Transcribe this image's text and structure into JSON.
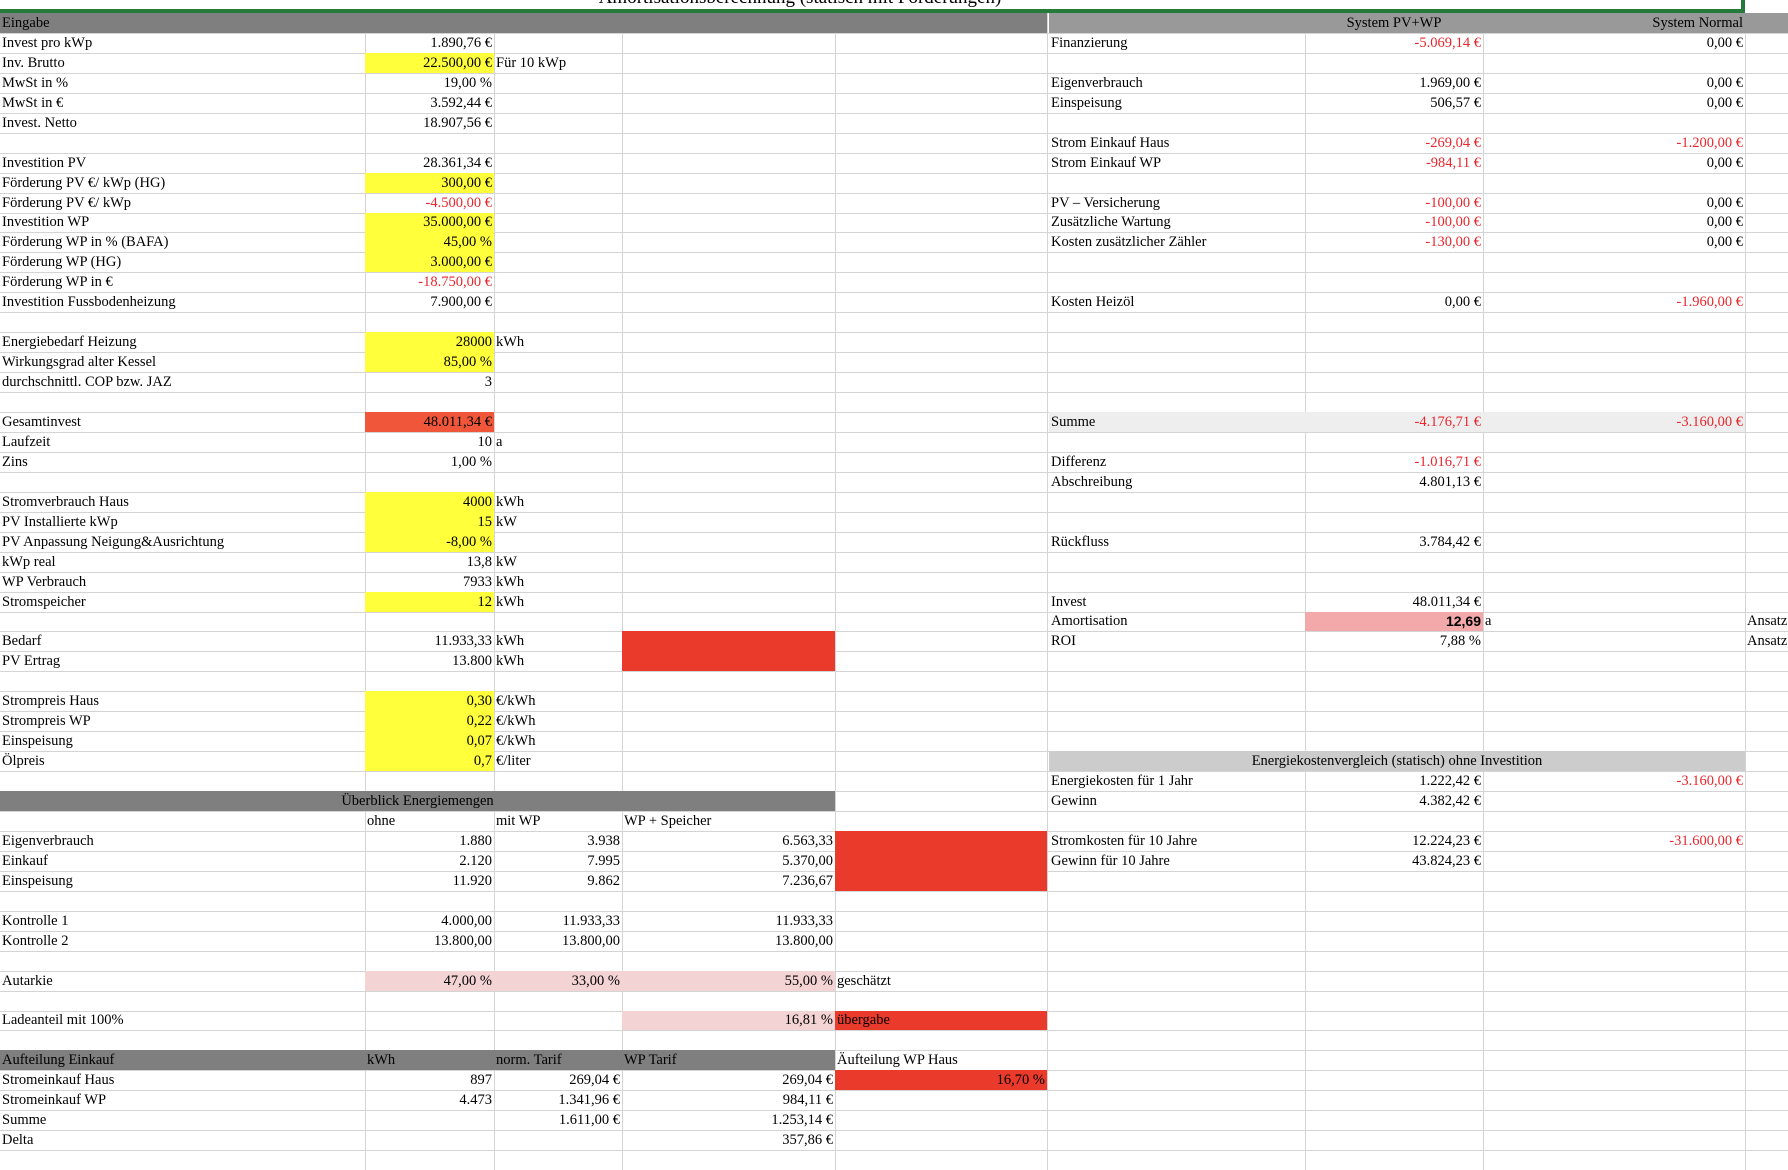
{
  "sheet_title": "Amortisationsberechnung (statisch mit Förderungen)",
  "cells": [
    {
      "r": 0,
      "c": 0,
      "t": "Eingabe"
    },
    {
      "r": 0,
      "c": 7,
      "t": "System PV+WP"
    },
    {
      "r": 0,
      "c": 8,
      "t": "System Normal"
    },
    {
      "r": 1,
      "c": 0,
      "t": "Invest pro kWp"
    },
    {
      "r": 1,
      "c": 1,
      "t": "1.890,76 €"
    },
    {
      "r": 1,
      "c": 6,
      "t": "Finanzierung"
    },
    {
      "r": 1,
      "c": 7,
      "t": "-5.069,14 €"
    },
    {
      "r": 1,
      "c": 8,
      "t": "0,00 €"
    },
    {
      "r": 2,
      "c": 0,
      "t": "Inv. Brutto"
    },
    {
      "r": 2,
      "c": 1,
      "t": "22.500,00 €"
    },
    {
      "r": 2,
      "c": 2,
      "t": "Für 10 kWp"
    },
    {
      "r": 3,
      "c": 0,
      "t": "MwSt in %"
    },
    {
      "r": 3,
      "c": 1,
      "t": "19,00 %"
    },
    {
      "r": 3,
      "c": 6,
      "t": "Eigenverbrauch"
    },
    {
      "r": 3,
      "c": 7,
      "t": "1.969,00 €"
    },
    {
      "r": 3,
      "c": 8,
      "t": "0,00 €"
    },
    {
      "r": 4,
      "c": 0,
      "t": "MwSt in €"
    },
    {
      "r": 4,
      "c": 1,
      "t": "3.592,44 €"
    },
    {
      "r": 4,
      "c": 6,
      "t": "Einspeisung"
    },
    {
      "r": 4,
      "c": 7,
      "t": "506,57 €"
    },
    {
      "r": 4,
      "c": 8,
      "t": "0,00 €"
    },
    {
      "r": 5,
      "c": 0,
      "t": "Invest. Netto"
    },
    {
      "r": 5,
      "c": 1,
      "t": "18.907,56 €"
    },
    {
      "r": 6,
      "c": 6,
      "t": "Strom Einkauf Haus"
    },
    {
      "r": 6,
      "c": 7,
      "t": "-269,04 €"
    },
    {
      "r": 6,
      "c": 8,
      "t": "-1.200,00 €"
    },
    {
      "r": 7,
      "c": 0,
      "t": "Investition PV"
    },
    {
      "r": 7,
      "c": 1,
      "t": "28.361,34 €"
    },
    {
      "r": 7,
      "c": 6,
      "t": "Strom Einkauf WP"
    },
    {
      "r": 7,
      "c": 7,
      "t": "-984,11 €"
    },
    {
      "r": 7,
      "c": 8,
      "t": "0,00 €"
    },
    {
      "r": 8,
      "c": 0,
      "t": "Förderung PV €/ kWp (HG)"
    },
    {
      "r": 8,
      "c": 1,
      "t": "300,00 €"
    },
    {
      "r": 9,
      "c": 0,
      "t": "Förderung PV €/ kWp"
    },
    {
      "r": 9,
      "c": 1,
      "t": "-4.500,00 €"
    },
    {
      "r": 9,
      "c": 6,
      "t": "PV – Versicherung"
    },
    {
      "r": 9,
      "c": 7,
      "t": "-100,00 €"
    },
    {
      "r": 9,
      "c": 8,
      "t": "0,00 €"
    },
    {
      "r": 10,
      "c": 0,
      "t": "Investition WP"
    },
    {
      "r": 10,
      "c": 1,
      "t": "35.000,00 €"
    },
    {
      "r": 10,
      "c": 6,
      "t": "Zusätzliche Wartung"
    },
    {
      "r": 10,
      "c": 7,
      "t": "-100,00 €"
    },
    {
      "r": 10,
      "c": 8,
      "t": "0,00 €"
    },
    {
      "r": 11,
      "c": 0,
      "t": "Förderung WP in % (BAFA)"
    },
    {
      "r": 11,
      "c": 1,
      "t": "45,00 %"
    },
    {
      "r": 11,
      "c": 6,
      "t": "Kosten zusätzlicher Zähler"
    },
    {
      "r": 11,
      "c": 7,
      "t": "-130,00 €"
    },
    {
      "r": 11,
      "c": 8,
      "t": "0,00 €"
    },
    {
      "r": 12,
      "c": 0,
      "t": "Förderung WP (HG)"
    },
    {
      "r": 12,
      "c": 1,
      "t": "3.000,00 €"
    },
    {
      "r": 13,
      "c": 0,
      "t": "Förderung WP in €"
    },
    {
      "r": 13,
      "c": 1,
      "t": "-18.750,00 €"
    },
    {
      "r": 14,
      "c": 0,
      "t": "Investition Fussbodenheizung"
    },
    {
      "r": 14,
      "c": 1,
      "t": "7.900,00 €"
    },
    {
      "r": 14,
      "c": 6,
      "t": "Kosten Heizöl"
    },
    {
      "r": 14,
      "c": 7,
      "t": "0,00 €"
    },
    {
      "r": 14,
      "c": 8,
      "t": "-1.960,00 €"
    },
    {
      "r": 16,
      "c": 0,
      "t": "Energiebedarf Heizung"
    },
    {
      "r": 16,
      "c": 1,
      "t": "28000"
    },
    {
      "r": 16,
      "c": 2,
      "t": "kWh"
    },
    {
      "r": 17,
      "c": 0,
      "t": "Wirkungsgrad alter Kessel"
    },
    {
      "r": 17,
      "c": 1,
      "t": "85,00 %"
    },
    {
      "r": 18,
      "c": 0,
      "t": "durchschnittl. COP bzw. JAZ"
    },
    {
      "r": 18,
      "c": 1,
      "t": "3"
    },
    {
      "r": 20,
      "c": 0,
      "t": "Gesamtinvest"
    },
    {
      "r": 20,
      "c": 1,
      "t": "48.011,34 €"
    },
    {
      "r": 20,
      "c": 6,
      "t": "Summe"
    },
    {
      "r": 20,
      "c": 7,
      "t": "-4.176,71 €"
    },
    {
      "r": 20,
      "c": 8,
      "t": "-3.160,00 €"
    },
    {
      "r": 21,
      "c": 0,
      "t": "Laufzeit"
    },
    {
      "r": 21,
      "c": 1,
      "t": "10"
    },
    {
      "r": 21,
      "c": 2,
      "t": "a"
    },
    {
      "r": 22,
      "c": 0,
      "t": "Zins"
    },
    {
      "r": 22,
      "c": 1,
      "t": "1,00 %"
    },
    {
      "r": 22,
      "c": 6,
      "t": "Differenz"
    },
    {
      "r": 22,
      "c": 7,
      "t": "-1.016,71 €"
    },
    {
      "r": 23,
      "c": 6,
      "t": "Abschreibung"
    },
    {
      "r": 23,
      "c": 7,
      "t": "4.801,13 €"
    },
    {
      "r": 24,
      "c": 0,
      "t": "Stromverbrauch Haus"
    },
    {
      "r": 24,
      "c": 1,
      "t": "4000"
    },
    {
      "r": 24,
      "c": 2,
      "t": "kWh"
    },
    {
      "r": 25,
      "c": 0,
      "t": "PV Installierte kWp"
    },
    {
      "r": 25,
      "c": 1,
      "t": "15"
    },
    {
      "r": 25,
      "c": 2,
      "t": "kW"
    },
    {
      "r": 26,
      "c": 0,
      "t": "PV Anpassung Neigung&Ausrichtung"
    },
    {
      "r": 26,
      "c": 1,
      "t": "-8,00 %"
    },
    {
      "r": 26,
      "c": 6,
      "t": "Rückfluss"
    },
    {
      "r": 26,
      "c": 7,
      "t": "3.784,42 €"
    },
    {
      "r": 27,
      "c": 0,
      "t": "kWp real"
    },
    {
      "r": 27,
      "c": 1,
      "t": "13,8"
    },
    {
      "r": 27,
      "c": 2,
      "t": "kW"
    },
    {
      "r": 28,
      "c": 0,
      "t": "WP Verbrauch"
    },
    {
      "r": 28,
      "c": 1,
      "t": "7933"
    },
    {
      "r": 28,
      "c": 2,
      "t": "kWh"
    },
    {
      "r": 29,
      "c": 0,
      "t": "Stromspeicher"
    },
    {
      "r": 29,
      "c": 1,
      "t": "12"
    },
    {
      "r": 29,
      "c": 2,
      "t": "kWh"
    },
    {
      "r": 29,
      "c": 6,
      "t": "Invest"
    },
    {
      "r": 29,
      "c": 7,
      "t": "48.011,34 €"
    },
    {
      "r": 30,
      "c": 6,
      "t": "Amortisation"
    },
    {
      "r": 30,
      "c": 7,
      "t": "12,69"
    },
    {
      "r": 30,
      "c": 8,
      "t": "a"
    },
    {
      "r": 30,
      "c": 10,
      "t": "Ansatz"
    },
    {
      "r": 31,
      "c": 0,
      "t": "Bedarf"
    },
    {
      "r": 31,
      "c": 1,
      "t": "11.933,33"
    },
    {
      "r": 31,
      "c": 2,
      "t": "kWh"
    },
    {
      "r": 31,
      "c": 6,
      "t": "ROI"
    },
    {
      "r": 31,
      "c": 7,
      "t": "7,88 %"
    },
    {
      "r": 31,
      "c": 10,
      "t": "Ansatz"
    },
    {
      "r": 32,
      "c": 0,
      "t": "PV Ertrag"
    },
    {
      "r": 32,
      "c": 1,
      "t": "13.800"
    },
    {
      "r": 32,
      "c": 2,
      "t": "kWh"
    },
    {
      "r": 34,
      "c": 0,
      "t": "Strompreis Haus"
    },
    {
      "r": 34,
      "c": 1,
      "t": "0,30"
    },
    {
      "r": 34,
      "c": 2,
      "t": "€/kWh"
    },
    {
      "r": 35,
      "c": 0,
      "t": "Strompreis WP"
    },
    {
      "r": 35,
      "c": 1,
      "t": "0,22"
    },
    {
      "r": 35,
      "c": 2,
      "t": "€/kWh"
    },
    {
      "r": 36,
      "c": 0,
      "t": "Einspeisung"
    },
    {
      "r": 36,
      "c": 1,
      "t": "0,07"
    },
    {
      "r": 36,
      "c": 2,
      "t": "€/kWh"
    },
    {
      "r": 37,
      "c": 0,
      "t": "Ölpreis"
    },
    {
      "r": 37,
      "c": 1,
      "t": "0,7"
    },
    {
      "r": 37,
      "c": 2,
      "t": "€/liter"
    },
    {
      "r": 37,
      "c": 6,
      "t": "Energiekostenvergleich (statisch) ohne Investition"
    },
    {
      "r": 38,
      "c": 6,
      "t": "Energiekosten für 1 Jahr"
    },
    {
      "r": 38,
      "c": 7,
      "t": "1.222,42 €"
    },
    {
      "r": 38,
      "c": 8,
      "t": "-3.160,00 €"
    },
    {
      "r": 39,
      "c": 0,
      "t": "Überblick Energiemengen"
    },
    {
      "r": 39,
      "c": 6,
      "t": "Gewinn"
    },
    {
      "r": 39,
      "c": 7,
      "t": "4.382,42 €"
    },
    {
      "r": 40,
      "c": 1,
      "t": "ohne"
    },
    {
      "r": 40,
      "c": 2,
      "t": "mit WP"
    },
    {
      "r": 40,
      "c": 3,
      "t": "WP + Speicher"
    },
    {
      "r": 41,
      "c": 0,
      "t": "Eigenverbrauch"
    },
    {
      "r": 41,
      "c": 1,
      "t": "1.880"
    },
    {
      "r": 41,
      "c": 2,
      "t": "3.938"
    },
    {
      "r": 41,
      "c": 3,
      "t": "6.563,33"
    },
    {
      "r": 41,
      "c": 6,
      "t": "Stromkosten für 10 Jahre"
    },
    {
      "r": 41,
      "c": 7,
      "t": "12.224,23 €"
    },
    {
      "r": 41,
      "c": 8,
      "t": "-31.600,00 €"
    },
    {
      "r": 42,
      "c": 0,
      "t": "Einkauf"
    },
    {
      "r": 42,
      "c": 1,
      "t": "2.120"
    },
    {
      "r": 42,
      "c": 2,
      "t": "7.995"
    },
    {
      "r": 42,
      "c": 3,
      "t": "5.370,00"
    },
    {
      "r": 42,
      "c": 6,
      "t": "Gewinn für 10 Jahre"
    },
    {
      "r": 42,
      "c": 7,
      "t": "43.824,23 €"
    },
    {
      "r": 43,
      "c": 0,
      "t": "Einspeisung"
    },
    {
      "r": 43,
      "c": 1,
      "t": "11.920"
    },
    {
      "r": 43,
      "c": 2,
      "t": "9.862"
    },
    {
      "r": 43,
      "c": 3,
      "t": "7.236,67"
    },
    {
      "r": 45,
      "c": 0,
      "t": "Kontrolle 1"
    },
    {
      "r": 45,
      "c": 1,
      "t": "4.000,00"
    },
    {
      "r": 45,
      "c": 2,
      "t": "11.933,33"
    },
    {
      "r": 45,
      "c": 3,
      "t": "11.933,33"
    },
    {
      "r": 46,
      "c": 0,
      "t": "Kontrolle 2"
    },
    {
      "r": 46,
      "c": 1,
      "t": "13.800,00"
    },
    {
      "r": 46,
      "c": 2,
      "t": "13.800,00"
    },
    {
      "r": 46,
      "c": 3,
      "t": "13.800,00"
    },
    {
      "r": 48,
      "c": 0,
      "t": "Autarkie"
    },
    {
      "r": 48,
      "c": 1,
      "t": "47,00 %"
    },
    {
      "r": 48,
      "c": 2,
      "t": "33,00 %"
    },
    {
      "r": 48,
      "c": 3,
      "t": "55,00 %"
    },
    {
      "r": 48,
      "c": 4,
      "t": "geschätzt"
    },
    {
      "r": 50,
      "c": 0,
      "t": "Ladeanteil mit 100%"
    },
    {
      "r": 50,
      "c": 3,
      "t": "16,81 %"
    },
    {
      "r": 50,
      "c": 4,
      "t": "übergabe"
    },
    {
      "r": 52,
      "c": 0,
      "t": "Aufteilung Einkauf"
    },
    {
      "r": 52,
      "c": 1,
      "t": "kWh"
    },
    {
      "r": 52,
      "c": 2,
      "t": "norm. Tarif"
    },
    {
      "r": 52,
      "c": 3,
      "t": "WP Tarif"
    },
    {
      "r": 52,
      "c": 4,
      "t": "Äufteilung WP Haus"
    },
    {
      "r": 53,
      "c": 0,
      "t": "Stromeinkauf Haus"
    },
    {
      "r": 53,
      "c": 1,
      "t": "897"
    },
    {
      "r": 53,
      "c": 2,
      "t": "269,04 €"
    },
    {
      "r": 53,
      "c": 3,
      "t": "269,04 €"
    },
    {
      "r": 53,
      "c": 4,
      "t": "16,70 %"
    },
    {
      "r": 54,
      "c": 0,
      "t": "Stromeinkauf WP"
    },
    {
      "r": 54,
      "c": 1,
      "t": "4.473"
    },
    {
      "r": 54,
      "c": 2,
      "t": "1.341,96 €"
    },
    {
      "r": 54,
      "c": 3,
      "t": "984,11 €"
    },
    {
      "r": 55,
      "c": 0,
      "t": "Summe"
    },
    {
      "r": 55,
      "c": 2,
      "t": "1.611,00 €"
    },
    {
      "r": 55,
      "c": 3,
      "t": "1.253,14 €"
    },
    {
      "r": 56,
      "c": 0,
      "t": "Delta"
    },
    {
      "r": 56,
      "c": 3,
      "t": "357,86 €"
    }
  ]
}
